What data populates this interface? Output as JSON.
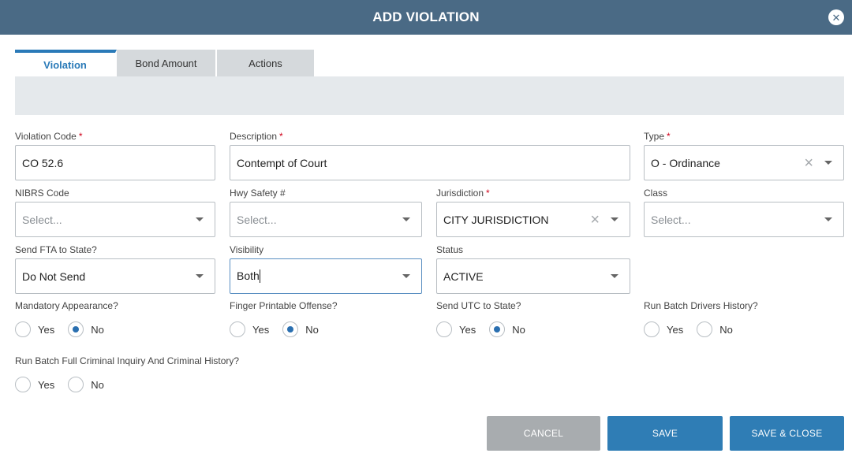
{
  "header": {
    "title": "ADD VIOLATION",
    "close_glyph": "✕"
  },
  "tabs": [
    {
      "label": "Violation",
      "active": true
    },
    {
      "label": "Bond Amount",
      "active": false
    },
    {
      "label": "Actions",
      "active": false
    }
  ],
  "required_mark": "*",
  "icons": {
    "clear": "×",
    "chevron": "chevron-down-icon",
    "close": "close-icon"
  },
  "fields": {
    "violation_code": {
      "label": "Violation Code",
      "value": "CO 52.6",
      "required": true
    },
    "description": {
      "label": "Description",
      "value": "Contempt of Court",
      "required": true
    },
    "type": {
      "label": "Type",
      "value": "O - Ordinance",
      "required": true
    },
    "nibrs_code": {
      "label": "NIBRS Code",
      "placeholder": "Select..."
    },
    "hwy_safety": {
      "label": "Hwy Safety #",
      "placeholder": "Select..."
    },
    "jurisdiction": {
      "label": "Jurisdiction",
      "value": "CITY JURISDICTION",
      "required": true
    },
    "class": {
      "label": "Class",
      "placeholder": "Select..."
    },
    "send_fta": {
      "label": "Send FTA to State?",
      "value": "Do Not Send"
    },
    "visibility": {
      "label": "Visibility",
      "value": "Both"
    },
    "status": {
      "label": "Status",
      "value": "ACTIVE"
    }
  },
  "radios": {
    "yes_label": "Yes",
    "no_label": "No",
    "mandatory_appearance": {
      "label": "Mandatory Appearance?",
      "selected": "No"
    },
    "finger_printable": {
      "label": "Finger Printable Offense?",
      "selected": "No"
    },
    "send_utc": {
      "label": "Send UTC to State?",
      "selected": "No"
    },
    "run_batch_drivers": {
      "label": "Run Batch Drivers History?",
      "selected": ""
    },
    "run_batch_criminal": {
      "label": "Run Batch Full Criminal Inquiry And Criminal History?",
      "selected": ""
    }
  },
  "buttons": {
    "cancel": "CANCEL",
    "save": "SAVE",
    "save_close": "SAVE & CLOSE"
  },
  "colors": {
    "header": "#4a6a85",
    "accent": "#2f7db5",
    "tab_active": "#2a7ab8",
    "cancel": "#a8acaf",
    "required": "#d0021b"
  }
}
